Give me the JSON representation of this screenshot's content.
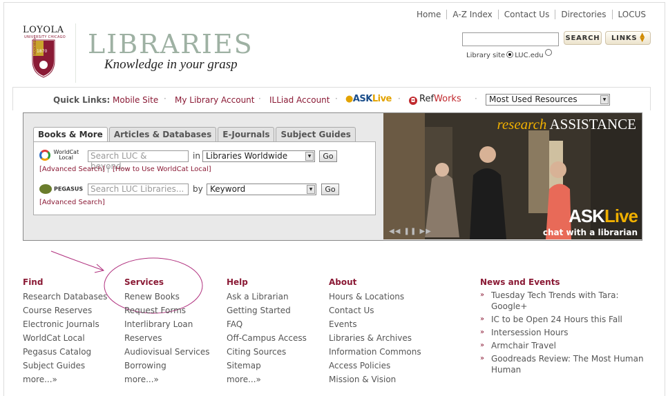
{
  "top_nav": [
    "Home",
    "A-Z Index",
    "Contact Us",
    "Directories",
    "LOCUS"
  ],
  "logo": {
    "word": "LOYOLA",
    "sub": "UNIVERSITY CHICAGO",
    "year": "1870",
    "motto": "AD MAIOREM DEI GLORIAM"
  },
  "header": {
    "title": "LIBRARIES",
    "tagline": "Knowledge in your grasp"
  },
  "search": {
    "button": "SEARCH",
    "links_button": "LINKS",
    "radio_library": "Library site",
    "radio_luc": "LUC.edu"
  },
  "quick_links": {
    "label": "Quick Links:",
    "items": [
      "Mobile Site",
      "My Library Account",
      "ILLiad Account"
    ],
    "ask": [
      "ASK",
      "Live"
    ],
    "refworks": [
      "Ref",
      "Works"
    ],
    "dropdown": "Most Used Resources"
  },
  "tabs": [
    "Books & More",
    "Articles & Databases",
    "E-Journals",
    "Subject Guides"
  ],
  "worldcat": {
    "logo": [
      "WorldCat",
      "Local"
    ],
    "placeholder": "Search LUC & beyond...",
    "in_label": "in",
    "scope": "Libraries Worldwide",
    "go": "Go",
    "links": [
      "[Advanced Search]",
      "[How to Use WorldCat Local]"
    ]
  },
  "pegasus": {
    "logo": "PEGASUS",
    "placeholder": "Search LUC Libraries...",
    "by_label": "by",
    "scope": "Keyword",
    "go": "Go",
    "links": [
      "[Advanced Search]"
    ]
  },
  "photo": {
    "title_a": "research",
    "title_b": "ASSISTANCE",
    "ask": [
      "ASK",
      "Live"
    ],
    "chat": "chat with a librarian"
  },
  "columns": {
    "find": {
      "heading": "Find",
      "items": [
        "Research Databases",
        "Course Reserves",
        "Electronic Journals",
        "WorldCat Local",
        "Pegasus Catalog",
        "Subject Guides"
      ],
      "more": "more...»"
    },
    "services": {
      "heading": "Services",
      "items": [
        "Renew Books",
        "Request Forms",
        "Interlibrary Loan",
        "Reserves",
        "Audiovisual Services",
        "Borrowing"
      ],
      "more": "more...»"
    },
    "help": {
      "heading": "Help",
      "items": [
        "Ask a Librarian",
        "Getting Started",
        "FAQ",
        "Off-Campus Access",
        "Citing Sources",
        "Sitemap"
      ],
      "more": "more...»"
    },
    "about": {
      "heading": "About",
      "items": [
        "Hours & Locations",
        "Contact Us",
        "Events",
        "Libraries & Archives",
        "Information Commons",
        "Access Policies",
        "Mission & Vision"
      ]
    },
    "news": {
      "heading": "News and Events",
      "items": [
        "Tuesday Tech Trends with Tara: Google+",
        "IC to be Open 24 Hours this Fall",
        "Intersession Hours",
        "Armchair Travel",
        "Goodreads Review: The Most Human Human"
      ]
    }
  },
  "colors": {
    "maroon": "#8a1a35",
    "sage": "#9eb1a3",
    "gold": "#f0b000",
    "annotation": "#a0207a"
  }
}
